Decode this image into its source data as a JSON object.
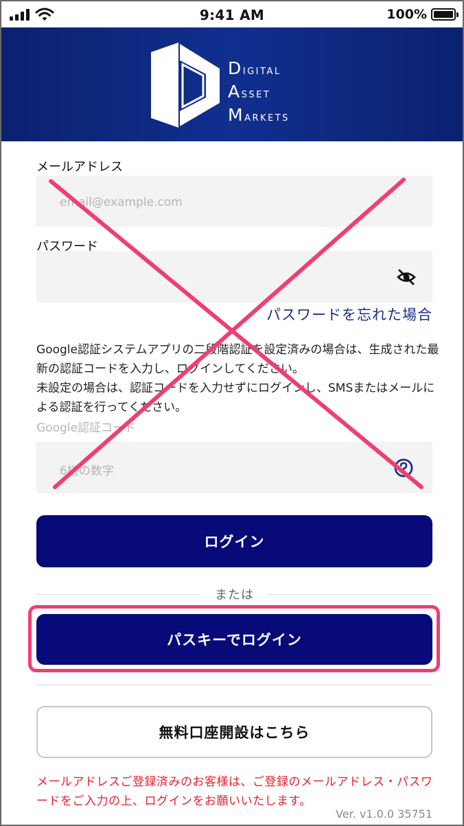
{
  "status_bar": {
    "time": "9:41 AM",
    "battery": "100%",
    "icons": [
      "signal-icon",
      "wifi-icon",
      "battery-icon"
    ]
  },
  "brand": {
    "line1": "Digital",
    "line2": "Asset",
    "line3": "Markets"
  },
  "form": {
    "email_label": "メールアドレス",
    "email_placeholder": "email@example.com",
    "email_value": "",
    "password_label": "パスワード",
    "password_value": "",
    "password_icon": "eye-off-icon",
    "forgot_link": "パスワードを忘れた場合",
    "info_text": "Google認証システムアプリの二段階認証を設定済みの場合は、生成された最新の認証コードを入力し、ログインしてください。\n未設定の場合は、認証コードを入力せずにログインし、SMSまたはメールによる認証を行ってください。",
    "code_label": "Google認証コード",
    "code_placeholder": "6桁の数字",
    "code_icon": "help-icon",
    "login_button": "ログイン",
    "or_text": "または",
    "passkey_button": "パスキーでログイン",
    "open_account_button": "無料口座開設はこちら",
    "notice": "メールアドレスご登録済みのお客様は、ご登録のメールアドレス・パスワードをご入力の上、ログインをお願いいたします。",
    "version": "Ver. v1.0.0 35751"
  },
  "annotations": {
    "cross_color": "#ee3f74",
    "highlight_color": "#ee3f74"
  },
  "colors": {
    "brand_navy": "#0a2170",
    "primary_button": "#070a78",
    "link": "#1b2f8f",
    "notice_red": "#e8202f"
  }
}
